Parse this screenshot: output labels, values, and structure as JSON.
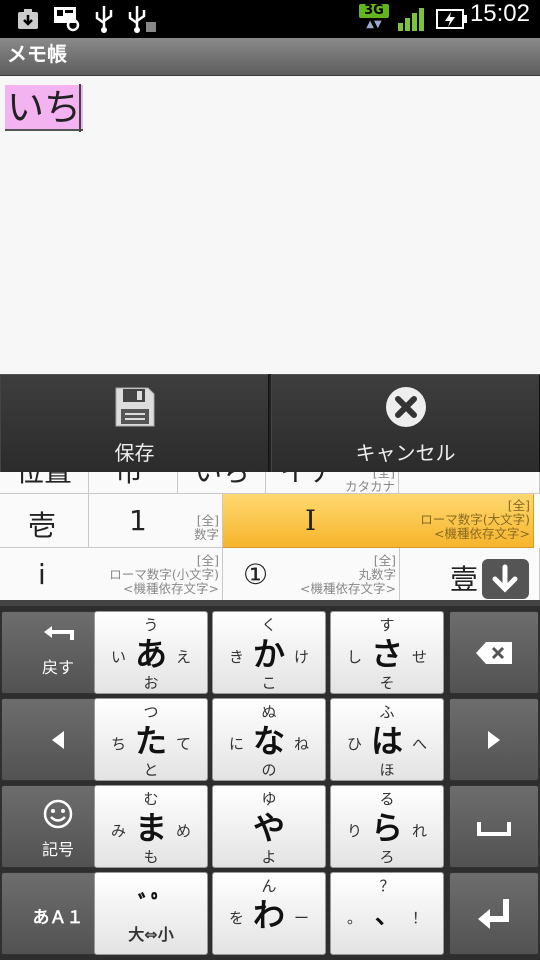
{
  "status_bar": {
    "time": "15:02",
    "network": "3G",
    "icons": [
      "download-icon",
      "media-icon",
      "usb-icon",
      "usb-debug-icon",
      "signal-icon",
      "battery-charging-icon"
    ]
  },
  "app": {
    "title": "メモ帳"
  },
  "editor": {
    "composing_text": "いち"
  },
  "action_bar": {
    "save_label": "保存",
    "cancel_label": "キャンセル"
  },
  "candidates": {
    "row1": [
      {
        "word": "位置",
        "ann": ""
      },
      {
        "word": "市",
        "ann": ""
      },
      {
        "word": "いち",
        "ann": ""
      },
      {
        "word": "イチ",
        "ann": "[全]\nカタカナ"
      }
    ],
    "row2": [
      {
        "word": "壱",
        "ann": ""
      },
      {
        "word": "1",
        "ann": "[全]\n数字"
      },
      {
        "word": "I",
        "ann": "[全]\nローマ数字(大文字)\n<機種依存文字>"
      }
    ],
    "row3": [
      {
        "word": "i",
        "ann": "[全]\nローマ数字(小文字)\n<機種依存文字>"
      },
      {
        "word": "①",
        "ann": "[全]\n丸数字\n<機種依存文字>"
      },
      {
        "word": "壹",
        "ann": ""
      }
    ]
  },
  "keyboard": {
    "back_label": "戻す",
    "symbol_label": "記号",
    "mode_label": "あＡ１",
    "rows": [
      [
        {
          "m": "あ",
          "u": "う",
          "l": "い",
          "r": "え",
          "d": "お"
        },
        {
          "m": "か",
          "u": "く",
          "l": "き",
          "r": "け",
          "d": "こ"
        },
        {
          "m": "さ",
          "u": "す",
          "l": "し",
          "r": "せ",
          "d": "そ"
        }
      ],
      [
        {
          "m": "た",
          "u": "つ",
          "l": "ち",
          "r": "て",
          "d": "と"
        },
        {
          "m": "な",
          "u": "ぬ",
          "l": "に",
          "r": "ね",
          "d": "の"
        },
        {
          "m": "は",
          "u": "ふ",
          "l": "ひ",
          "r": "へ",
          "d": "ほ"
        }
      ],
      [
        {
          "m": "ま",
          "u": "む",
          "l": "み",
          "r": "め",
          "d": "も"
        },
        {
          "m": "や",
          "u": "ゆ",
          "l": "",
          "r": "",
          "d": "よ"
        },
        {
          "m": "ら",
          "u": "る",
          "l": "り",
          "r": "れ",
          "d": "ろ"
        }
      ],
      [
        {
          "m": "ﾞﾟ",
          "u": "",
          "l": "",
          "r": "",
          "d": "大⇔小"
        },
        {
          "m": "わ",
          "u": "ん",
          "l": "を",
          "r": "ー",
          "d": ""
        },
        {
          "m": "、",
          "u": "？",
          "l": "。",
          "r": "！",
          "d": ""
        }
      ]
    ]
  }
}
